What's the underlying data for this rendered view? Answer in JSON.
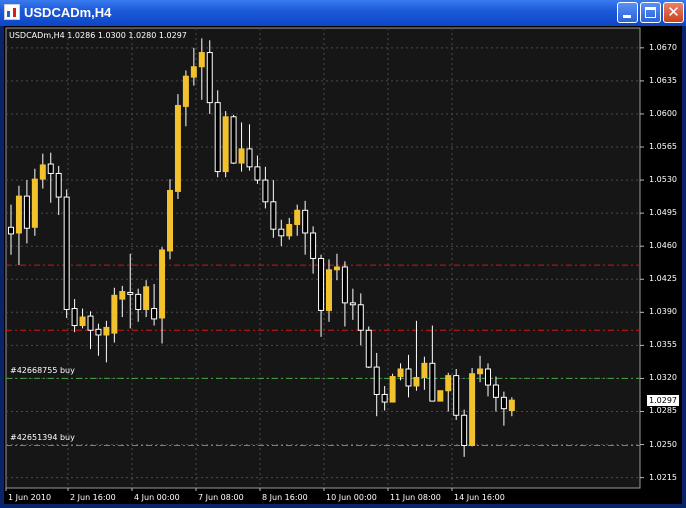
{
  "window": {
    "title": "USDCADm,H4",
    "controls": {
      "minimize": "minimize",
      "maximize": "maximize",
      "close": "✕"
    }
  },
  "chart": {
    "symbol_info": "USDCADm,H4 1.0286 1.0300 1.0280 1.0297",
    "colors": {
      "background": "#000000",
      "panel": "#161616",
      "grid": "#4a4a4a",
      "bull": "#f2c12e",
      "bear": "#000000",
      "candle_outline": "#ffffff",
      "sell_line": "#d01515",
      "buy_line": "#3fa83f"
    },
    "price_axis": {
      "ticks": [
        "1.0670",
        "1.0635",
        "1.0600",
        "1.0565",
        "1.0530",
        "1.0495",
        "1.0460",
        "1.0425",
        "1.0390",
        "1.0355",
        "1.0320",
        "1.0285",
        "1.0250",
        "1.0215"
      ],
      "range": [
        1.0204,
        1.0691
      ]
    },
    "time_axis": {
      "ticks": [
        "1 Jun 2010",
        "2 Jun 16:00",
        "4 Jun 00:00",
        "7 Jun 08:00",
        "8 Jun 16:00",
        "10 Jun 00:00",
        "11 Jun 08:00",
        "14 Jun 16:00"
      ]
    },
    "current_price": "1.0297",
    "orders": [
      {
        "label": "#42668755 buy",
        "price": 1.032,
        "kind": "buy"
      },
      {
        "label": "#42651394 buy",
        "price": 1.0249,
        "kind": "buy"
      }
    ],
    "levels": [
      {
        "price": 1.044,
        "kind": "sell"
      },
      {
        "price": 1.0371,
        "kind": "sell"
      }
    ]
  },
  "chart_data": {
    "type": "candlestick",
    "series": [
      {
        "name": "USDCADm,H4",
        "candles": [
          [
            1.048,
            1.0504,
            1.0451,
            1.0473
          ],
          [
            1.0474,
            1.0524,
            1.044,
            1.0513
          ],
          [
            1.0513,
            1.053,
            1.0463,
            1.0479
          ],
          [
            1.048,
            1.0542,
            1.0471,
            1.0531
          ],
          [
            1.0531,
            1.0558,
            1.0521,
            1.0546
          ],
          [
            1.0547,
            1.0559,
            1.0506,
            1.0537
          ],
          [
            1.0537,
            1.0545,
            1.0493,
            1.0512
          ],
          [
            1.0512,
            1.052,
            1.0384,
            1.0393
          ],
          [
            1.0394,
            1.0404,
            1.0369,
            1.0376
          ],
          [
            1.0376,
            1.0394,
            1.0373,
            1.0385
          ],
          [
            1.0386,
            1.0391,
            1.0351,
            1.0371
          ],
          [
            1.0372,
            1.0378,
            1.0344,
            1.0366
          ],
          [
            1.0366,
            1.0381,
            1.0337,
            1.0374
          ],
          [
            1.0368,
            1.0416,
            1.0358,
            1.0408
          ],
          [
            1.0404,
            1.0418,
            1.0385,
            1.0412
          ],
          [
            1.0411,
            1.0452,
            1.0373,
            1.0409
          ],
          [
            1.0409,
            1.0415,
            1.038,
            1.0393
          ],
          [
            1.0393,
            1.0424,
            1.0385,
            1.0417
          ],
          [
            1.0394,
            1.042,
            1.0376,
            1.0383
          ],
          [
            1.0384,
            1.0459,
            1.0357,
            1.0456
          ],
          [
            1.0455,
            1.0531,
            1.0446,
            1.0519
          ],
          [
            1.0518,
            1.0621,
            1.051,
            1.0609
          ],
          [
            1.0608,
            1.0646,
            1.0587,
            1.064
          ],
          [
            1.0639,
            1.067,
            1.063,
            1.065
          ],
          [
            1.065,
            1.068,
            1.0615,
            1.0665
          ],
          [
            1.0665,
            1.0678,
            1.06,
            1.0612
          ],
          [
            1.0612,
            1.0625,
            1.0533,
            1.0539
          ],
          [
            1.0539,
            1.0603,
            1.0533,
            1.0597
          ],
          [
            1.0597,
            1.0599,
            1.0547,
            1.0548
          ],
          [
            1.0548,
            1.0591,
            1.0539,
            1.0563
          ],
          [
            1.0563,
            1.0589,
            1.054,
            1.0544
          ],
          [
            1.0544,
            1.0556,
            1.0526,
            1.053
          ],
          [
            1.053,
            1.0544,
            1.05,
            1.0507
          ],
          [
            1.0507,
            1.053,
            1.0469,
            1.0478
          ],
          [
            1.0478,
            1.0488,
            1.046,
            1.0471
          ],
          [
            1.0471,
            1.049,
            1.0467,
            1.0483
          ],
          [
            1.0483,
            1.0504,
            1.0471,
            1.0498
          ],
          [
            1.0498,
            1.0508,
            1.0451,
            1.0474
          ],
          [
            1.0474,
            1.0481,
            1.0431,
            1.0447
          ],
          [
            1.0447,
            1.0451,
            1.0364,
            1.0392
          ],
          [
            1.0392,
            1.0446,
            1.038,
            1.0435
          ],
          [
            1.0435,
            1.0452,
            1.0424,
            1.0438
          ],
          [
            1.0438,
            1.0444,
            1.0375,
            1.04
          ],
          [
            1.04,
            1.0415,
            1.0382,
            1.0398
          ],
          [
            1.0398,
            1.041,
            1.0355,
            1.0371
          ],
          [
            1.0371,
            1.0375,
            1.0331,
            1.0332
          ],
          [
            1.0332,
            1.0347,
            1.028,
            1.0303
          ],
          [
            1.0303,
            1.0312,
            1.0286,
            1.0295
          ],
          [
            1.0295,
            1.0325,
            1.0295,
            1.0322
          ],
          [
            1.0322,
            1.0336,
            1.0318,
            1.033
          ],
          [
            1.033,
            1.0345,
            1.03,
            1.0312
          ],
          [
            1.0312,
            1.0381,
            1.0307,
            1.0321
          ],
          [
            1.0321,
            1.0343,
            1.0308,
            1.0336
          ],
          [
            1.0336,
            1.0376,
            1.0297,
            1.0296
          ],
          [
            1.0296,
            1.0303,
            1.0298,
            1.0307
          ],
          [
            1.0307,
            1.0326,
            1.0285,
            1.0323
          ],
          [
            1.0323,
            1.033,
            1.0276,
            1.0281
          ],
          [
            1.0281,
            1.0287,
            1.0237,
            1.0249
          ],
          [
            1.0249,
            1.0331,
            1.0248,
            1.0325
          ],
          [
            1.0325,
            1.0344,
            1.0316,
            1.033
          ],
          [
            1.033,
            1.0336,
            1.0301,
            1.0313
          ],
          [
            1.0313,
            1.0322,
            1.0285,
            1.03
          ],
          [
            1.03,
            1.0306,
            1.027,
            1.0288
          ],
          [
            1.0286,
            1.03,
            1.028,
            1.0297
          ]
        ]
      }
    ],
    "y_ticks": [
      "1.0670",
      "1.0635",
      "1.0600",
      "1.0565",
      "1.0530",
      "1.0495",
      "1.0460",
      "1.0425",
      "1.0390",
      "1.0355",
      "1.0320",
      "1.0285",
      "1.0250",
      "1.0215"
    ],
    "x_ticks": [
      "1 Jun 2010",
      "2 Jun 16:00",
      "4 Jun 00:00",
      "7 Jun 08:00",
      "8 Jun 16:00",
      "10 Jun 00:00",
      "11 Jun 08:00",
      "14 Jun 16:00"
    ],
    "ylim": [
      1.0204,
      1.0691
    ],
    "grid": true
  }
}
